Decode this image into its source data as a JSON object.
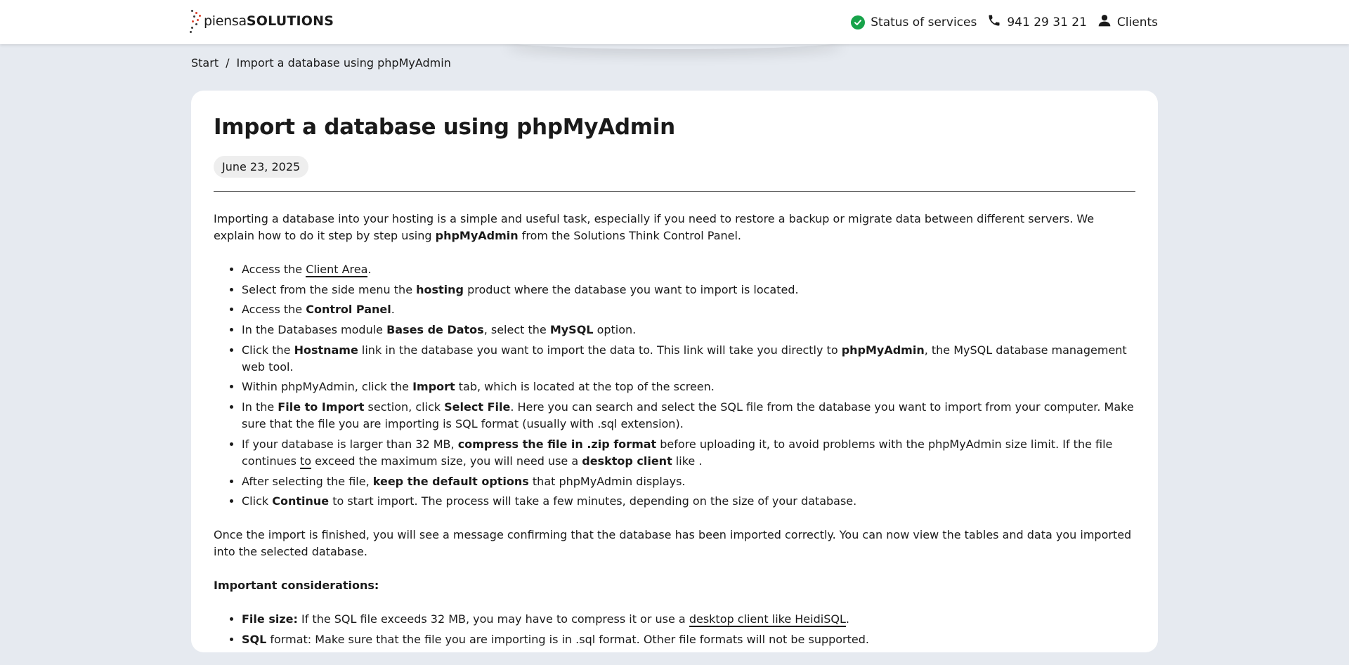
{
  "header": {
    "logo_light": "piensa",
    "logo_bold": "SOLUTIONS",
    "status_label": "Status of services",
    "phone": "941 29 31 21",
    "clients_label": "Clients"
  },
  "breadcrumb": {
    "start": "Start",
    "separator": "/",
    "current": "Import a database using phpMyAdmin"
  },
  "article": {
    "title": "Import a database using phpMyAdmin",
    "date": "June 23, 2025",
    "intro": {
      "t1": "Importing a database into your hosting is a simple and useful task, especially if you need to restore a backup or migrate data between different servers. We explain how to do it step by step using ",
      "b1": "phpMyAdmin",
      "t2": " from the Solutions Think Control Panel."
    },
    "steps": {
      "s1": {
        "t1": "Access the ",
        "link": "Client Area",
        "t2": "."
      },
      "s2": {
        "t1": "Select from the side menu the ",
        "b1": "hosting",
        "t2": " product where the database you want to import is located."
      },
      "s3": {
        "t1": "Access the ",
        "b1": "Control Panel",
        "t2": "."
      },
      "s4": {
        "t1": "In the Databases module ",
        "b1": "Bases de Datos",
        "t2": ", select the ",
        "b2": "MySQL",
        "t3": " option."
      },
      "s5": {
        "t1": "Click the ",
        "b1": "Hostname",
        "t2": " link in the database you want to import the data to. This link will take you directly to ",
        "b2": "phpMyAdmin",
        "t3": ", the MySQL database management web tool."
      },
      "s6": {
        "t1": "Within phpMyAdmin, click the ",
        "b1": "Import",
        "t2": " tab, which is located at the top of the screen."
      },
      "s7": {
        "t1": "In the ",
        "b1": "File to Import",
        "t2": " section, click ",
        "b2": "Select File",
        "t3": ". Here you can search and select the SQL file from the database you want to import from your computer. Make sure that the file you are importing is SQL format (usually with .sql extension)."
      },
      "s8": {
        "t1": "If your database is larger than 32 MB, ",
        "b1": "compress the file in .zip format",
        "t2": " before uploading it, to avoid problems with the phpMyAdmin size limit. If the file continues ",
        "link": "to",
        "t3": " exceed the maximum size, you will need use a ",
        "b2": "desktop client",
        "t4": " like ."
      },
      "s9": {
        "t1": "After selecting the file, ",
        "b1": "keep the default options",
        "t2": " that phpMyAdmin displays."
      },
      "s10": {
        "t1": "Click ",
        "b1": "Continue",
        "t2": " to start import. The process will take a few minutes, depending on the size of your database."
      }
    },
    "outro": "Once the import is finished, you will see a message confirming that the database has been imported correctly. You can now view the tables and data you imported into the selected database.",
    "considerations_heading": "Important considerations:",
    "considerations": {
      "c1": {
        "b1": "File size:",
        "t1": " If the SQL file exceeds 32 MB, you may have to compress it or use a ",
        "link": "desktop client like HeidiSQL",
        "t2": "."
      },
      "c2": {
        "b1": "SQL",
        "t1": " format: Make sure that the file you are importing is in .sql format. Other file formats will not be supported."
      }
    }
  },
  "colors": {
    "background": "#e6eaf0",
    "status_ok": "#17a34a",
    "logo_dots_dark": "#3a3a3a",
    "logo_dots_accent": "#d9402b"
  },
  "icons": {
    "status": "check-circle-icon",
    "phone": "phone-icon",
    "clients": "user-icon"
  }
}
